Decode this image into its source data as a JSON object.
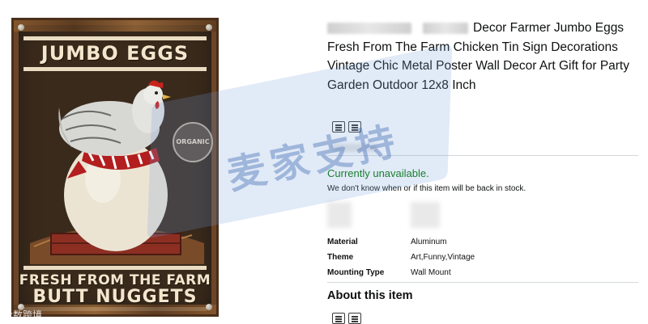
{
  "sign": {
    "headline": "JUMBO EGGS",
    "footer_line_1": "FRESH FROM THE FARM",
    "footer_line_2": "BUTT NUGGETS",
    "badge": "ORGANIC"
  },
  "watermark": {
    "text": "麦家支持",
    "corner": "大数跨境"
  },
  "product": {
    "title": "Decor Farmer Jumbo Eggs Fresh From The Farm Chicken Tin Sign Decorations Vintage Chic Metal Poster Wall Decor Art Gift for Party Garden Outdoor 12x8 Inch"
  },
  "availability": {
    "status": "Currently unavailable.",
    "note": "We don't know when or if this item will be back in stock."
  },
  "specs": [
    {
      "label": "Material",
      "value": "Aluminum"
    },
    {
      "label": "Theme",
      "value": "Art,Funny,Vintage"
    },
    {
      "label": "Mounting Type",
      "value": "Wall Mount"
    }
  ],
  "about": {
    "heading": "About this item"
  },
  "colors": {
    "availability_green": "#007600",
    "text": "#0f1111",
    "divider": "#d5d9d9"
  }
}
